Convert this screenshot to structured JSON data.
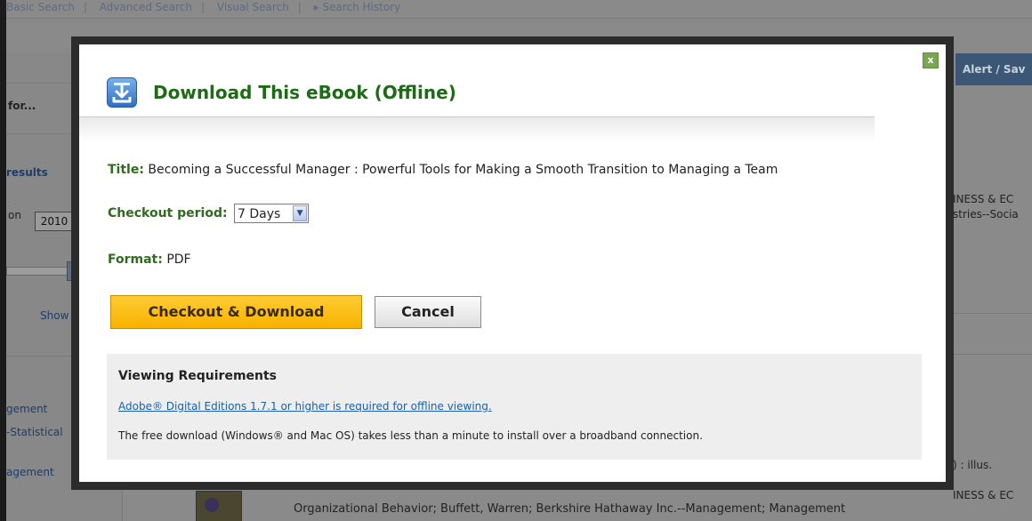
{
  "background": {
    "topnav": {
      "basic_search": "Basic Search",
      "advanced_search": "Advanced Search",
      "visual_search": "Visual Search",
      "search_history": "▸ Search History"
    },
    "left_panel": {
      "search_for": "for...",
      "results": "results",
      "on_label": "on",
      "year": "2010",
      "show": "Show",
      "item1": "gement",
      "item2": "-Statistical",
      "item3": "agement"
    },
    "alert_tab": "Alert / Sav",
    "right_snippets": {
      "s1": "INESS & EC",
      "s2": "stries--Socia",
      "s3": ") : illus.",
      "s4": "INESS & EC"
    },
    "bottom_line": "Organizational Behavior; Buffett, Warren; Berkshire Hathaway Inc.--Management; Management"
  },
  "modal": {
    "close_label": "x",
    "title": "Download This eBook (Offline)",
    "title_field": {
      "label": "Title:",
      "value": "Becoming a Successful Manager : Powerful Tools for Making a Smooth Transition to Managing a Team"
    },
    "checkout_field": {
      "label": "Checkout period:",
      "value": "7 Days"
    },
    "format_field": {
      "label": "Format:",
      "value": "PDF"
    },
    "checkout_button": "Checkout & Download",
    "cancel_button": "Cancel",
    "requirements": {
      "heading": "Viewing Requirements",
      "link": "Adobe® Digital Editions 1.7.1 or higher is required for offline viewing.",
      "note": "The free download (Windows® and Mac OS) takes less than a minute to install over a broadband connection."
    }
  }
}
